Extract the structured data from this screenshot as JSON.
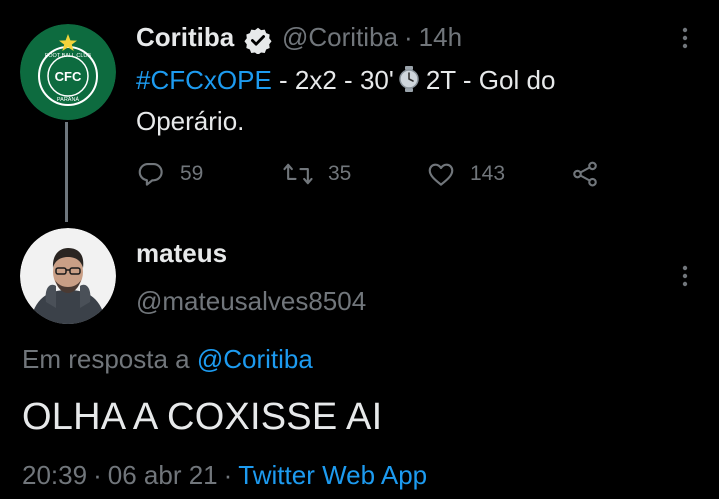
{
  "parent_tweet": {
    "display_name": "Coritiba",
    "handle": "@Coritiba",
    "separator": "·",
    "time": "14h",
    "hashtag": "#CFCxOPE",
    "text_line1_after_hashtag": " - 2x2 - 30'",
    "text_line1_after_icon": "2T - Gol do",
    "text_line2": "Operário.",
    "avatar_icon": "coritiba-crest-icon",
    "counts": {
      "replies": "59",
      "retweets": "35",
      "likes": "143"
    }
  },
  "reply_tweet": {
    "display_name": "mateus",
    "handle": "@mateusalves8504",
    "in_reply_prefix": "Em resposta a ",
    "in_reply_mention": "@Coritiba",
    "body": "OLHA A COXISSE AI",
    "time": "20:39",
    "separator": "·",
    "date": "06 abr 21",
    "source": "Twitter Web App"
  },
  "colors": {
    "background": "#000000",
    "text": "#e7e9ea",
    "muted": "#71767b",
    "accent": "#1d9bf0",
    "crest_green": "#0d6b3f"
  }
}
